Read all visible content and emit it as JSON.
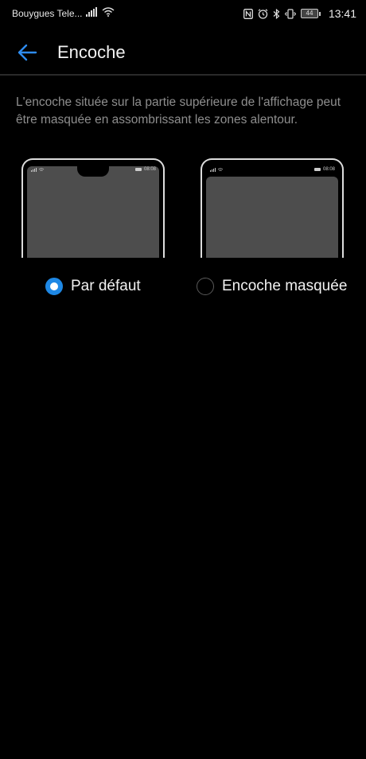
{
  "status_bar": {
    "carrier": "Bouygues Tele...",
    "battery": "44",
    "time": "13:41"
  },
  "app_bar": {
    "title": "Encoche"
  },
  "description": "L'encoche située sur la partie supérieure de l'affichage peut être masquée en assombrissant les zones alentour.",
  "previews": {
    "mini_time": "08:08"
  },
  "options": [
    {
      "label": "Par défaut",
      "selected": true
    },
    {
      "label": "Encoche masquée",
      "selected": false
    }
  ],
  "colors": {
    "accent": "#1e88e5",
    "background": "#000000",
    "description_text": "#8e8e8e"
  }
}
